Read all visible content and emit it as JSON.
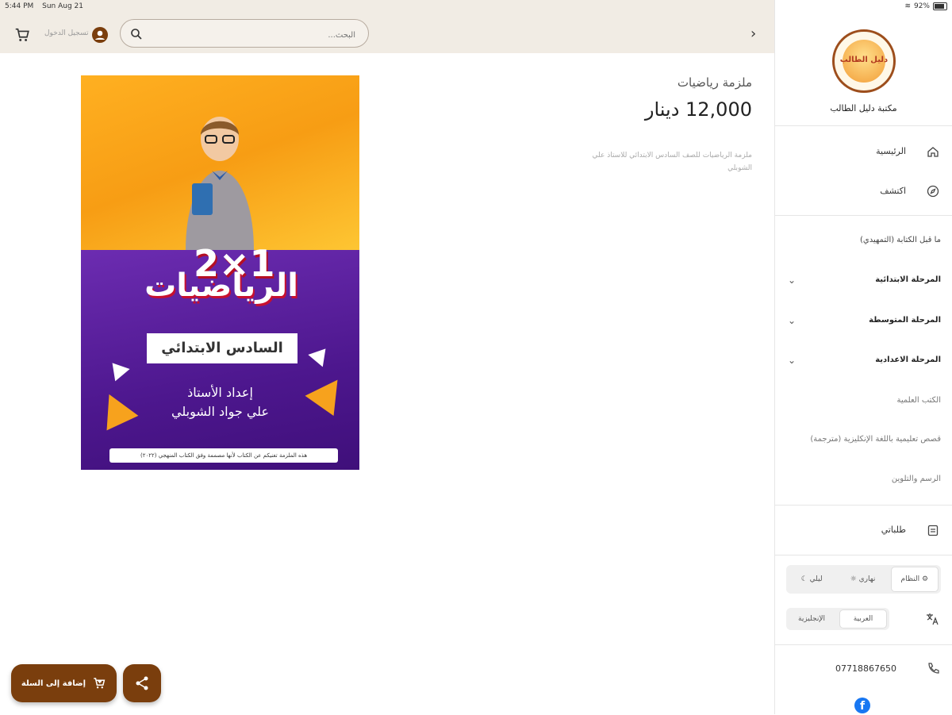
{
  "status_bar": {
    "time": "5:44 PM",
    "date": "Sun Aug 21",
    "battery": "92%"
  },
  "header": {
    "login_label": "تسجيل الدخول",
    "search_placeholder": "البحث..."
  },
  "product": {
    "title": "ملزمة رياضيات",
    "price": "12,000 دينار",
    "description": "ملزمة الرياضيات للصف السادس الابتدائي للاستاذ علي الشوبلي",
    "image": {
      "number": "2×1",
      "title": "الرياضيات",
      "grade": "السادس الابتدائي",
      "author_line1": "إعداد الأستاذ",
      "author_line2": "علي جواد الشوبلي",
      "footer": "هذه الملزمة تغنيكم عن الكتاب لأنها مصممة وفق الكتاب المنهجي (٢٠٢٢)"
    }
  },
  "actions": {
    "add_to_cart": "إضافة إلى السلة"
  },
  "sidebar": {
    "logo_text": "دليل الطالب",
    "store_name": "مكتبة دليل الطالب",
    "nav": [
      {
        "label": "الرئيسية",
        "icon": "home-icon"
      },
      {
        "label": "اكتشف",
        "icon": "compass-icon"
      }
    ],
    "categories": [
      {
        "label": "ما قبل الكتابة (التمهيدي)",
        "expandable": false
      },
      {
        "label": "المرحلة الابتدائية",
        "expandable": true
      },
      {
        "label": "المرحلة المتوسطة",
        "expandable": true
      },
      {
        "label": "المرحلة الاعدادية",
        "expandable": true
      },
      {
        "label": "الكتب العلمية",
        "expandable": false
      },
      {
        "label": "قصص تعليمية باللغة الإنكليزية (مترجمة)",
        "expandable": false
      },
      {
        "label": "الرسم والتلوين",
        "expandable": false
      }
    ],
    "orders_label": "طلباتي",
    "theme": {
      "system": "النظام",
      "light": "نهاري",
      "dark": "ليلي",
      "selected": "النظام"
    },
    "language": {
      "arabic": "العربية",
      "english": "الإنجليزية",
      "selected": "العربية"
    },
    "phone": "07718867650"
  },
  "colors": {
    "brand": "#7a3e0d",
    "topbar_bg": "#f1ece4"
  }
}
